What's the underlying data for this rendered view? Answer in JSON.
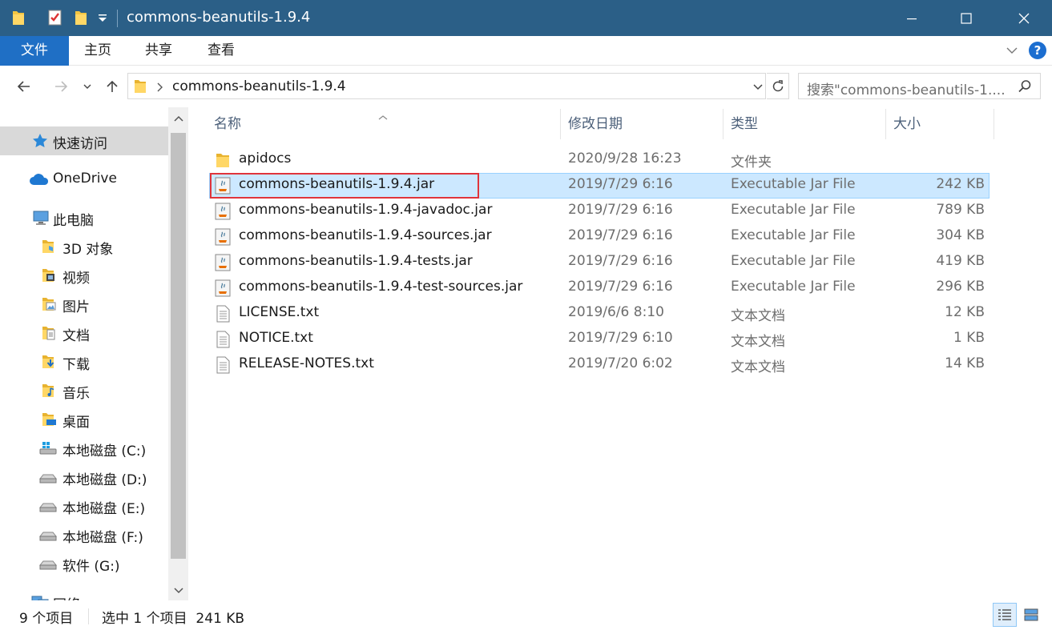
{
  "window": {
    "title": "commons-beanutils-1.9.4",
    "minimize_glyph": "—",
    "maximize_glyph": "☐",
    "close_glyph": "✕"
  },
  "ribbon": {
    "tabs": [
      "文件",
      "主页",
      "共享",
      "查看"
    ],
    "help_glyph": "?"
  },
  "address": {
    "path": "commons-beanutils-1.9.4",
    "search_placeholder": "搜索\"commons-beanutils-1...."
  },
  "sidebar": {
    "items": [
      {
        "label": "快速访问",
        "icon": "star-icon"
      },
      {
        "label": "OneDrive",
        "icon": "cloud-icon"
      },
      {
        "label": "此电脑",
        "icon": "computer-icon"
      },
      {
        "label": "3D 对象",
        "icon": "folder-3d-icon"
      },
      {
        "label": "视频",
        "icon": "folder-video-icon"
      },
      {
        "label": "图片",
        "icon": "folder-pictures-icon"
      },
      {
        "label": "文档",
        "icon": "folder-documents-icon"
      },
      {
        "label": "下载",
        "icon": "folder-downloads-icon"
      },
      {
        "label": "音乐",
        "icon": "folder-music-icon"
      },
      {
        "label": "桌面",
        "icon": "folder-desktop-icon"
      },
      {
        "label": "本地磁盘 (C:)",
        "icon": "drive-c-icon"
      },
      {
        "label": "本地磁盘 (D:)",
        "icon": "drive-icon"
      },
      {
        "label": "本地磁盘 (E:)",
        "icon": "drive-icon"
      },
      {
        "label": "本地磁盘 (F:)",
        "icon": "drive-icon"
      },
      {
        "label": "软件 (G:)",
        "icon": "drive-icon"
      },
      {
        "label": "网络",
        "icon": "network-icon"
      }
    ]
  },
  "columns": {
    "name": "名称",
    "date": "修改日期",
    "type": "类型",
    "size": "大小"
  },
  "files": [
    {
      "name": "apidocs",
      "date": "2020/9/28 16:23",
      "type": "文件夹",
      "size": "",
      "icon": "folder-icon"
    },
    {
      "name": "commons-beanutils-1.9.4.jar",
      "date": "2019/7/29 6:16",
      "type": "Executable Jar File",
      "size": "242 KB",
      "icon": "jar-icon"
    },
    {
      "name": "commons-beanutils-1.9.4-javadoc.jar",
      "date": "2019/7/29 6:16",
      "type": "Executable Jar File",
      "size": "789 KB",
      "icon": "jar-icon"
    },
    {
      "name": "commons-beanutils-1.9.4-sources.jar",
      "date": "2019/7/29 6:16",
      "type": "Executable Jar File",
      "size": "304 KB",
      "icon": "jar-icon"
    },
    {
      "name": "commons-beanutils-1.9.4-tests.jar",
      "date": "2019/7/29 6:16",
      "type": "Executable Jar File",
      "size": "419 KB",
      "icon": "jar-icon"
    },
    {
      "name": "commons-beanutils-1.9.4-test-sources.jar",
      "date": "2019/7/29 6:16",
      "type": "Executable Jar File",
      "size": "296 KB",
      "icon": "jar-icon"
    },
    {
      "name": "LICENSE.txt",
      "date": "2019/6/6 8:10",
      "type": "文本文档",
      "size": "12 KB",
      "icon": "text-file-icon"
    },
    {
      "name": "NOTICE.txt",
      "date": "2019/7/29 6:10",
      "type": "文本文档",
      "size": "1 KB",
      "icon": "text-file-icon"
    },
    {
      "name": "RELEASE-NOTES.txt",
      "date": "2019/7/20 6:02",
      "type": "文本文档",
      "size": "14 KB",
      "icon": "text-file-icon"
    }
  ],
  "status": {
    "item_count": "9 个项目",
    "selection": "选中 1 个项目  241 KB"
  },
  "colors": {
    "titlebar": "#2b5f87",
    "file_tab": "#1f6fc5",
    "selection_fill": "#cce8ff",
    "selection_border": "#99d1ff",
    "highlight": "#e0343b"
  }
}
